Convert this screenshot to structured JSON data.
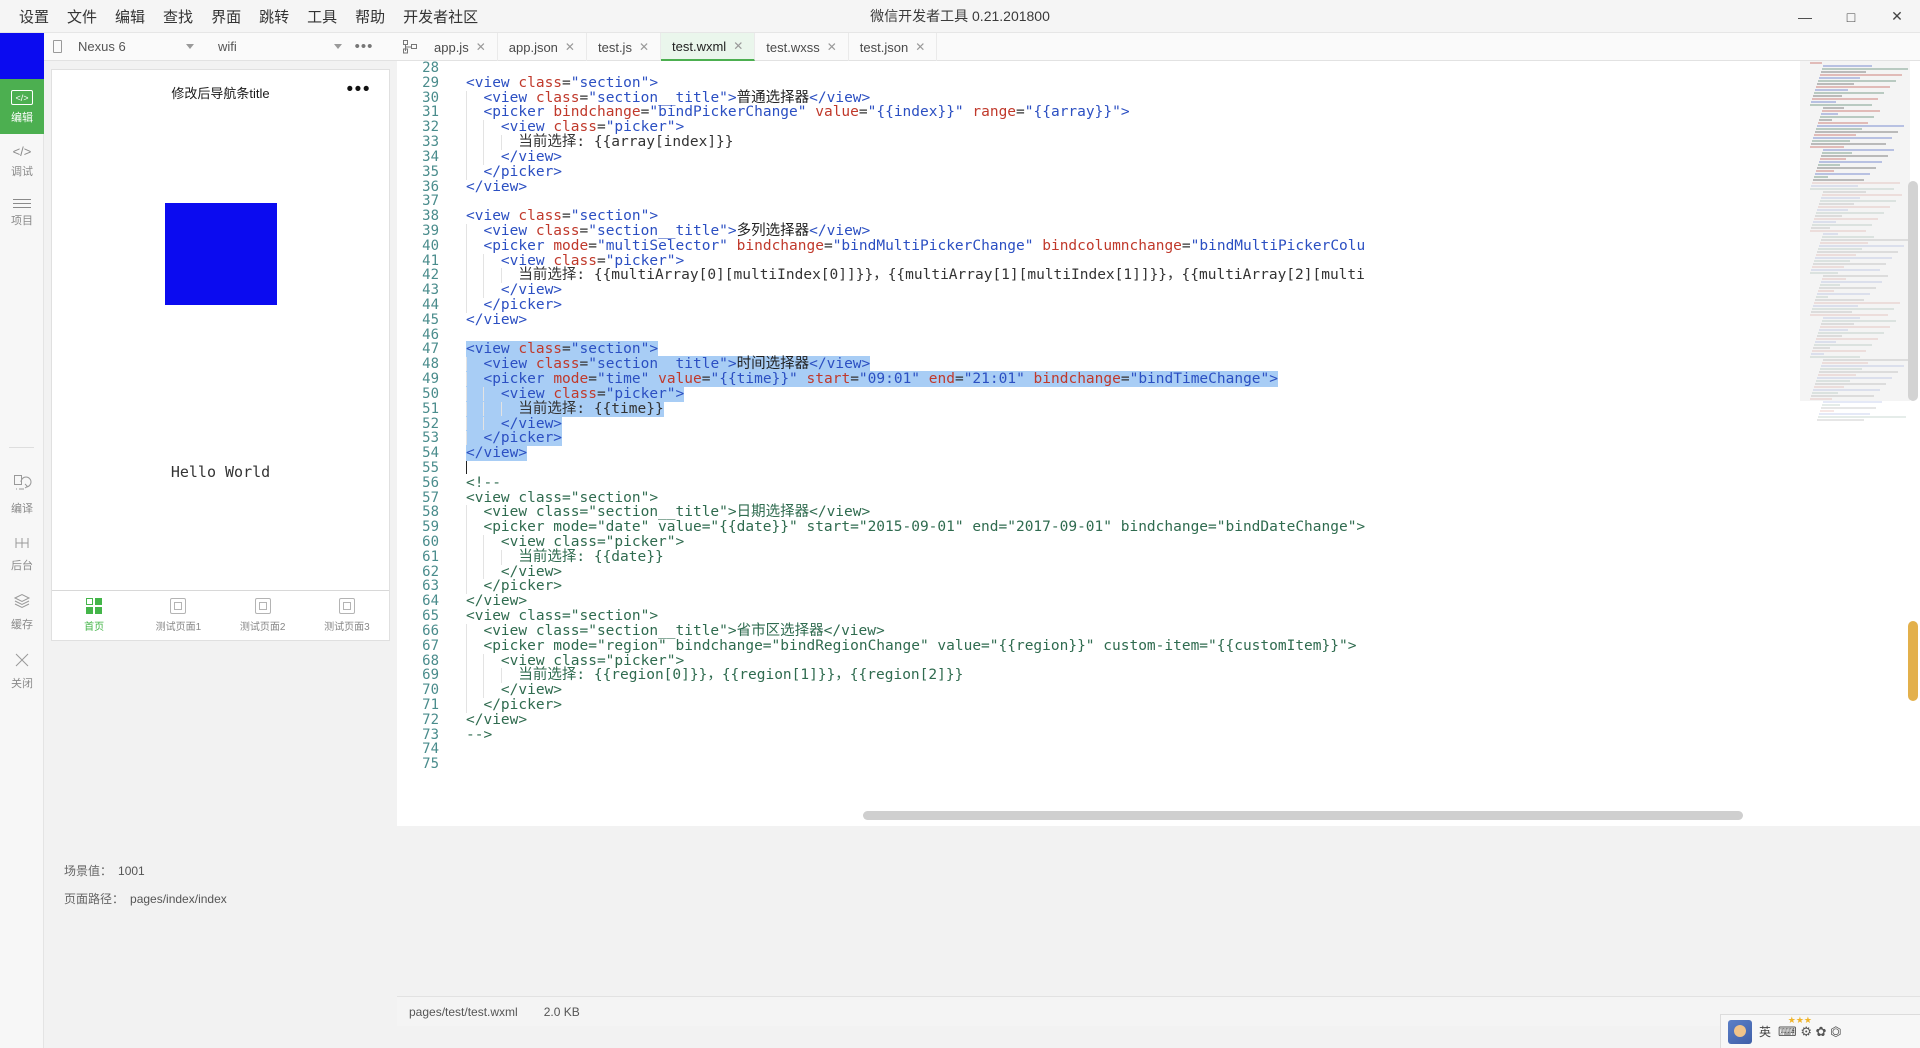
{
  "window": {
    "title": "微信开发者工具 0.21.201800",
    "controls": {
      "minimize": "—",
      "maximize": "□",
      "close": "✕"
    }
  },
  "menubar": [
    {
      "label": "设置"
    },
    {
      "label": "文件"
    },
    {
      "label": "编辑"
    },
    {
      "label": "查找"
    },
    {
      "label": "界面"
    },
    {
      "label": "跳转"
    },
    {
      "label": "工具"
    },
    {
      "label": "帮助"
    },
    {
      "label": "开发者社区"
    }
  ],
  "toolbar": {
    "device": "Nexus 6",
    "network": "wifi",
    "more": "•••"
  },
  "tabs": [
    {
      "label": "app.js",
      "close": "✕",
      "active": false
    },
    {
      "label": "app.json",
      "close": "✕",
      "active": false
    },
    {
      "label": "test.js",
      "close": "✕",
      "active": false
    },
    {
      "label": "test.wxml",
      "close": "✕",
      "active": true
    },
    {
      "label": "test.wxss",
      "close": "✕",
      "active": false
    },
    {
      "label": "test.json",
      "close": "✕",
      "active": false
    }
  ],
  "rail": [
    {
      "label": "编辑",
      "icon": "code-box-icon",
      "active": true
    },
    {
      "label": "调试",
      "icon": "angle-brackets-icon",
      "active": false
    },
    {
      "label": "项目",
      "icon": "list-icon",
      "active": false
    },
    {
      "label": "编译",
      "icon": "compile-icon",
      "active": false
    },
    {
      "label": "后台",
      "icon": "background-icon",
      "active": false
    },
    {
      "label": "缓存",
      "icon": "cache-icon",
      "active": false
    },
    {
      "label": "关闭",
      "icon": "close-x-icon",
      "active": false
    }
  ],
  "simulator": {
    "nav_title": "修改后导航条title",
    "nav_more": "•••",
    "hello_text": "Hello World",
    "tabbar": [
      {
        "label": "首页",
        "active": true
      },
      {
        "label": "测试页面1",
        "active": false
      },
      {
        "label": "测试页面2",
        "active": false
      },
      {
        "label": "测试页面3",
        "active": false
      }
    ],
    "meta": [
      {
        "label": "场景值：",
        "value": "1001"
      },
      {
        "label": "页面路径：",
        "value": "pages/index/index"
      }
    ]
  },
  "statusbar": {
    "path": "pages/test/test.wxml",
    "size": "2.0 KB"
  },
  "ime": {
    "lang": "英",
    "glyphs": "⌨ ⚙ ✿ ⏣",
    "stars": "★★★"
  },
  "editor": {
    "language": "wxml",
    "selection_lines": [
      47,
      48,
      49,
      50,
      51,
      52,
      53,
      54
    ],
    "caret_line": 55,
    "lines": [
      {
        "n": 28,
        "segments": []
      },
      {
        "n": 29,
        "segments": [
          {
            "t": "<view ",
            "c": "tag"
          },
          {
            "t": "class",
            "c": "attr"
          },
          {
            "t": "=",
            "c": "punct"
          },
          {
            "t": "\"section\"",
            "c": "str"
          },
          {
            "t": ">",
            "c": "tag"
          }
        ]
      },
      {
        "n": 30,
        "segments": [
          {
            "t": "  <view ",
            "c": "tag"
          },
          {
            "t": "class",
            "c": "attr"
          },
          {
            "t": "=",
            "c": "punct"
          },
          {
            "t": "\"section__title\"",
            "c": "str"
          },
          {
            "t": ">",
            "c": "tag"
          },
          {
            "t": "普通选择器",
            "c": "cn"
          },
          {
            "t": "</view>",
            "c": "tag"
          }
        ]
      },
      {
        "n": 31,
        "segments": [
          {
            "t": "  <picker ",
            "c": "tag"
          },
          {
            "t": "bindchange",
            "c": "attr"
          },
          {
            "t": "=",
            "c": "punct"
          },
          {
            "t": "\"bindPickerChange\"",
            "c": "str"
          },
          {
            "t": " ",
            "c": "punct"
          },
          {
            "t": "value",
            "c": "attr"
          },
          {
            "t": "=",
            "c": "punct"
          },
          {
            "t": "\"{{index}}\"",
            "c": "str"
          },
          {
            "t": " ",
            "c": "punct"
          },
          {
            "t": "range",
            "c": "attr"
          },
          {
            "t": "=",
            "c": "punct"
          },
          {
            "t": "\"{{array}}\"",
            "c": "str"
          },
          {
            "t": ">",
            "c": "tag"
          }
        ]
      },
      {
        "n": 32,
        "segments": [
          {
            "t": "    <view ",
            "c": "tag"
          },
          {
            "t": "class",
            "c": "attr"
          },
          {
            "t": "=",
            "c": "punct"
          },
          {
            "t": "\"picker\"",
            "c": "str"
          },
          {
            "t": ">",
            "c": "tag"
          }
        ]
      },
      {
        "n": 33,
        "segments": [
          {
            "t": "      当前选择: {{array[index]}}",
            "c": "txt"
          }
        ]
      },
      {
        "n": 34,
        "segments": [
          {
            "t": "    </view>",
            "c": "tag"
          }
        ]
      },
      {
        "n": 35,
        "segments": [
          {
            "t": "  </picker>",
            "c": "tag"
          }
        ]
      },
      {
        "n": 36,
        "segments": [
          {
            "t": "</view>",
            "c": "tag"
          }
        ]
      },
      {
        "n": 37,
        "segments": []
      },
      {
        "n": 38,
        "segments": [
          {
            "t": "<view ",
            "c": "tag"
          },
          {
            "t": "class",
            "c": "attr"
          },
          {
            "t": "=",
            "c": "punct"
          },
          {
            "t": "\"section\"",
            "c": "str"
          },
          {
            "t": ">",
            "c": "tag"
          }
        ]
      },
      {
        "n": 39,
        "segments": [
          {
            "t": "  <view ",
            "c": "tag"
          },
          {
            "t": "class",
            "c": "attr"
          },
          {
            "t": "=",
            "c": "punct"
          },
          {
            "t": "\"section__title\"",
            "c": "str"
          },
          {
            "t": ">",
            "c": "tag"
          },
          {
            "t": "多列选择器",
            "c": "cn"
          },
          {
            "t": "</view>",
            "c": "tag"
          }
        ]
      },
      {
        "n": 40,
        "segments": [
          {
            "t": "  <picker ",
            "c": "tag"
          },
          {
            "t": "mode",
            "c": "attr"
          },
          {
            "t": "=",
            "c": "punct"
          },
          {
            "t": "\"multiSelector\"",
            "c": "str"
          },
          {
            "t": " ",
            "c": "punct"
          },
          {
            "t": "bindchange",
            "c": "attr"
          },
          {
            "t": "=",
            "c": "punct"
          },
          {
            "t": "\"bindMultiPickerChange\"",
            "c": "str"
          },
          {
            "t": " ",
            "c": "punct"
          },
          {
            "t": "bindcolumnchange",
            "c": "attr"
          },
          {
            "t": "=",
            "c": "punct"
          },
          {
            "t": "\"bindMultiPickerColu",
            "c": "str"
          }
        ]
      },
      {
        "n": 41,
        "segments": [
          {
            "t": "    <view ",
            "c": "tag"
          },
          {
            "t": "class",
            "c": "attr"
          },
          {
            "t": "=",
            "c": "punct"
          },
          {
            "t": "\"picker\"",
            "c": "str"
          },
          {
            "t": ">",
            "c": "tag"
          }
        ]
      },
      {
        "n": 42,
        "segments": [
          {
            "t": "      当前选择: {{multiArray[0][multiIndex[0]]}}，{{multiArray[1][multiIndex[1]]}}，{{multiArray[2][multi",
            "c": "txt"
          }
        ]
      },
      {
        "n": 43,
        "segments": [
          {
            "t": "    </view>",
            "c": "tag"
          }
        ]
      },
      {
        "n": 44,
        "segments": [
          {
            "t": "  </picker>",
            "c": "tag"
          }
        ]
      },
      {
        "n": 45,
        "segments": [
          {
            "t": "</view>",
            "c": "tag"
          }
        ]
      },
      {
        "n": 46,
        "segments": []
      },
      {
        "n": 47,
        "segments": [
          {
            "t": "<view ",
            "c": "tag"
          },
          {
            "t": "class",
            "c": "attr"
          },
          {
            "t": "=",
            "c": "punct"
          },
          {
            "t": "\"section\"",
            "c": "str"
          },
          {
            "t": ">",
            "c": "tag"
          }
        ]
      },
      {
        "n": 48,
        "segments": [
          {
            "t": "  <view ",
            "c": "tag"
          },
          {
            "t": "class",
            "c": "attr"
          },
          {
            "t": "=",
            "c": "punct"
          },
          {
            "t": "\"section__title\"",
            "c": "str"
          },
          {
            "t": ">",
            "c": "tag"
          },
          {
            "t": "时间选择器",
            "c": "cn"
          },
          {
            "t": "</view>",
            "c": "tag"
          }
        ]
      },
      {
        "n": 49,
        "segments": [
          {
            "t": "  <picker ",
            "c": "tag"
          },
          {
            "t": "mode",
            "c": "attr"
          },
          {
            "t": "=",
            "c": "punct"
          },
          {
            "t": "\"time\"",
            "c": "str"
          },
          {
            "t": " ",
            "c": "punct"
          },
          {
            "t": "value",
            "c": "attr"
          },
          {
            "t": "=",
            "c": "punct"
          },
          {
            "t": "\"{{time}}\"",
            "c": "str"
          },
          {
            "t": " ",
            "c": "punct"
          },
          {
            "t": "start",
            "c": "attr"
          },
          {
            "t": "=",
            "c": "punct"
          },
          {
            "t": "\"09:01\"",
            "c": "str"
          },
          {
            "t": " ",
            "c": "punct"
          },
          {
            "t": "end",
            "c": "attr"
          },
          {
            "t": "=",
            "c": "punct"
          },
          {
            "t": "\"21:01\"",
            "c": "str"
          },
          {
            "t": " ",
            "c": "punct"
          },
          {
            "t": "bindchange",
            "c": "attr"
          },
          {
            "t": "=",
            "c": "punct"
          },
          {
            "t": "\"bindTimeChange\"",
            "c": "str"
          },
          {
            "t": ">",
            "c": "tag"
          }
        ]
      },
      {
        "n": 50,
        "segments": [
          {
            "t": "    <view ",
            "c": "tag"
          },
          {
            "t": "class",
            "c": "attr"
          },
          {
            "t": "=",
            "c": "punct"
          },
          {
            "t": "\"picker\"",
            "c": "str"
          },
          {
            "t": ">",
            "c": "tag"
          }
        ]
      },
      {
        "n": 51,
        "segments": [
          {
            "t": "      当前选择: {{time}}",
            "c": "txt"
          }
        ]
      },
      {
        "n": 52,
        "segments": [
          {
            "t": "    </view>",
            "c": "tag"
          }
        ]
      },
      {
        "n": 53,
        "segments": [
          {
            "t": "  </picker>",
            "c": "tag"
          }
        ]
      },
      {
        "n": 54,
        "segments": [
          {
            "t": "</view>",
            "c": "tag"
          }
        ]
      },
      {
        "n": 55,
        "segments": []
      },
      {
        "n": 56,
        "segments": [
          {
            "t": "<!--",
            "c": "comment"
          }
        ]
      },
      {
        "n": 57,
        "segments": [
          {
            "t": "<view class=\"section\">",
            "c": "comment"
          }
        ]
      },
      {
        "n": 58,
        "segments": [
          {
            "t": "  <view class=\"section__title\">日期选择器</view>",
            "c": "comment"
          }
        ]
      },
      {
        "n": 59,
        "segments": [
          {
            "t": "  <picker mode=\"date\" value=\"{{date}}\" start=\"2015-09-01\" end=\"2017-09-01\" bindchange=\"bindDateChange\">",
            "c": "comment"
          }
        ]
      },
      {
        "n": 60,
        "segments": [
          {
            "t": "    <view class=\"picker\">",
            "c": "comment"
          }
        ]
      },
      {
        "n": 61,
        "segments": [
          {
            "t": "      当前选择: {{date}}",
            "c": "comment"
          }
        ]
      },
      {
        "n": 62,
        "segments": [
          {
            "t": "    </view>",
            "c": "comment"
          }
        ]
      },
      {
        "n": 63,
        "segments": [
          {
            "t": "  </picker>",
            "c": "comment"
          }
        ]
      },
      {
        "n": 64,
        "segments": [
          {
            "t": "</view>",
            "c": "comment"
          }
        ]
      },
      {
        "n": 65,
        "segments": [
          {
            "t": "<view class=\"section\">",
            "c": "comment"
          }
        ]
      },
      {
        "n": 66,
        "segments": [
          {
            "t": "  <view class=\"section__title\">省市区选择器</view>",
            "c": "comment"
          }
        ]
      },
      {
        "n": 67,
        "segments": [
          {
            "t": "  <picker mode=\"region\" bindchange=\"bindRegionChange\" value=\"{{region}}\" custom-item=\"{{customItem}}\">",
            "c": "comment"
          }
        ]
      },
      {
        "n": 68,
        "segments": [
          {
            "t": "    <view class=\"picker\">",
            "c": "comment"
          }
        ]
      },
      {
        "n": 69,
        "segments": [
          {
            "t": "      当前选择: {{region[0]}}，{{region[1]}}，{{region[2]}}",
            "c": "comment"
          }
        ]
      },
      {
        "n": 70,
        "segments": [
          {
            "t": "    </view>",
            "c": "comment"
          }
        ]
      },
      {
        "n": 71,
        "segments": [
          {
            "t": "  </picker>",
            "c": "comment"
          }
        ]
      },
      {
        "n": 72,
        "segments": [
          {
            "t": "</view>",
            "c": "comment"
          }
        ]
      },
      {
        "n": 73,
        "segments": [
          {
            "t": "-->",
            "c": "comment"
          }
        ]
      },
      {
        "n": 74,
        "segments": []
      },
      {
        "n": 75,
        "segments": []
      }
    ]
  }
}
